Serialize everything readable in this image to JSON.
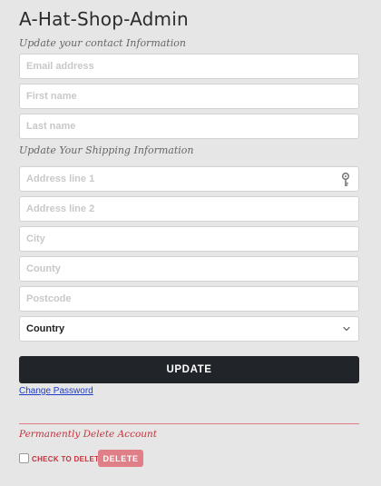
{
  "app": {
    "title": "A-Hat-Shop-Admin"
  },
  "contact": {
    "label": "Update your contact Information",
    "email_placeholder": "Email address",
    "first_name_placeholder": "First name",
    "last_name_placeholder": "Last name"
  },
  "shipping": {
    "label": "Update Your Shipping Information",
    "address1_placeholder": "Address line 1",
    "address2_placeholder": "Address line 2",
    "city_placeholder": "City",
    "county_placeholder": "County",
    "postcode_placeholder": "Postcode",
    "country_value": "Country"
  },
  "actions": {
    "update_label": "UPDATE",
    "change_password_label": "Change Password"
  },
  "danger": {
    "label": "Permanently Delete Account",
    "check_label": "CHECK TO DELETE",
    "delete_label": "DELETE"
  },
  "icons": {
    "autofill": "key-icon",
    "dropdown": "chevron-down-icon",
    "checkbox": "checkbox-icon"
  },
  "colors": {
    "background": "#e6e6e6",
    "primary_button": "#212429",
    "danger_text": "#c3323c",
    "danger_button": "#e07f88",
    "link": "#1f3cc7"
  }
}
